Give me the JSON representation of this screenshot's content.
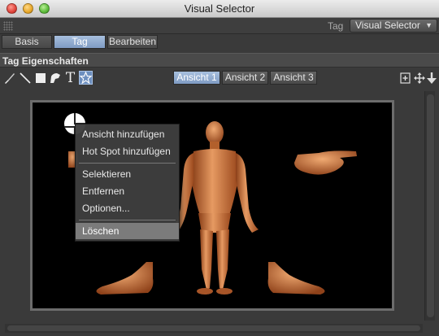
{
  "window": {
    "title": "Visual Selector"
  },
  "tagbar": {
    "label": "Tag",
    "selected": "Visual Selector"
  },
  "tabs": [
    {
      "label": "Basis"
    },
    {
      "label": "Tag"
    },
    {
      "label": "Bearbeiten"
    }
  ],
  "active_tab": "Tag",
  "section": {
    "title": "Tag Eigenschaften"
  },
  "tools": [
    {
      "icon": "brush-icon"
    },
    {
      "icon": "line-icon"
    },
    {
      "icon": "rectangle-icon"
    },
    {
      "icon": "polygon-icon"
    },
    {
      "icon": "text-icon",
      "glyph": "T"
    },
    {
      "icon": "star-icon"
    }
  ],
  "views": [
    {
      "label": "Ansicht 1"
    },
    {
      "label": "Ansicht 2"
    },
    {
      "label": "Ansicht 3"
    }
  ],
  "active_view": "Ansicht 1",
  "context_menu": {
    "items": [
      {
        "label": "Ansicht hinzufügen"
      },
      {
        "label": "Hot Spot hinzufügen"
      },
      {
        "label": "Selektieren"
      },
      {
        "label": "Entfernen"
      },
      {
        "label": "Optionen..."
      },
      {
        "label": "Löschen"
      }
    ],
    "highlighted": "Löschen"
  },
  "colors": {
    "accent": "#7f9bc3",
    "skin": "#d9824a",
    "canvas_bg": "#000000"
  }
}
